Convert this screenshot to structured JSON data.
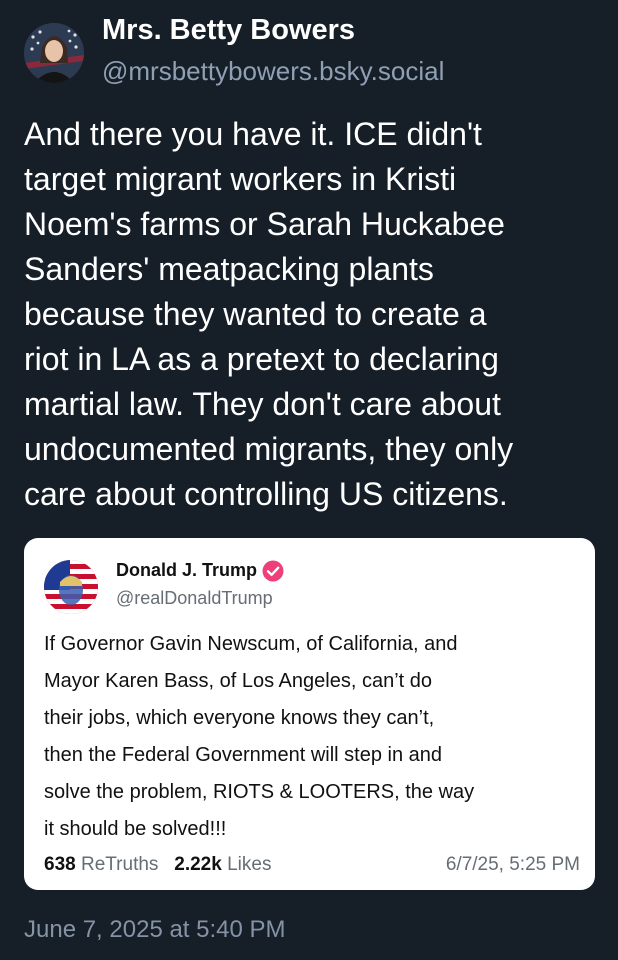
{
  "author": {
    "display_name": "Mrs. Betty Bowers",
    "handle": "@mrsbettybowers.bsky.social"
  },
  "post": {
    "lines": [
      "And there you have it. ICE didn't",
      "target migrant workers in Kristi",
      "Noem's farms or Sarah Huckabee",
      "Sanders' meatpacking plants",
      "because they wanted to create a",
      "riot in LA as a pretext to declaring",
      "martial law. They don't care about",
      "undocumented migrants, they only",
      "care about controlling US citizens."
    ],
    "timestamp": "June 7, 2025 at 5:40 PM"
  },
  "quote": {
    "display_name": "Donald J. Trump",
    "handle": "@realDonaldTrump",
    "lines": [
      "If Governor Gavin Newscum, of California, and",
      "Mayor Karen Bass, of Los Angeles, can’t do",
      "their jobs, which everyone knows they can’t,",
      "then the Federal Government will step in and",
      "solve the problem, RIOTS & LOOTERS, the way",
      "it should be solved!!!"
    ],
    "retruths_count": "638",
    "retruths_label": "ReTruths",
    "likes_count": "2.22k",
    "likes_label": "Likes",
    "date": "6/7/25, 5:25 PM"
  },
  "colors": {
    "background": "#161e28",
    "verified_badge": "#ee3f7a"
  }
}
